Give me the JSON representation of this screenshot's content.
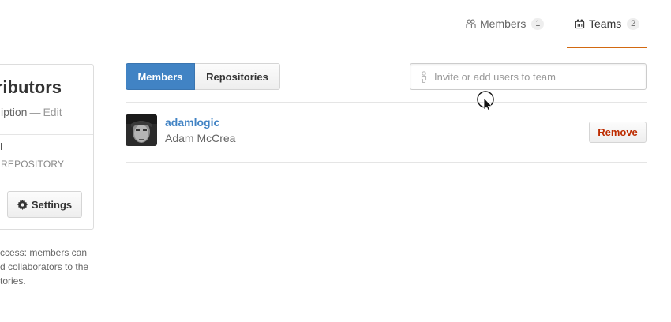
{
  "nav": {
    "members_label": "Members",
    "members_count": "1",
    "teams_label": "Teams",
    "teams_count": "2",
    "active_tab": "Teams",
    "active_color": "#d26911"
  },
  "sidebar": {
    "title": "ributors",
    "description": "iption",
    "description_sep": "—",
    "edit_label": "Edit",
    "repo_label": "REPOSITORY",
    "settings_label": "Settings",
    "note_lines": [
      "ccess: members can",
      "d collaborators to the",
      "tories."
    ]
  },
  "tabs": {
    "members_label": "Members",
    "repositories_label": "Repositories",
    "active": "Members",
    "accent_color": "#4183c4"
  },
  "invite": {
    "placeholder": "Invite or add users to team",
    "value": ""
  },
  "members": [
    {
      "login": "adamlogic",
      "name": "Adam McCrea",
      "remove_label": "Remove"
    }
  ],
  "icons": {
    "members_tab": "members-icon",
    "teams_tab": "teams-icon",
    "settings": "gear-icon",
    "invite": "person-icon",
    "cursor": "mouse-pointer-icon"
  }
}
